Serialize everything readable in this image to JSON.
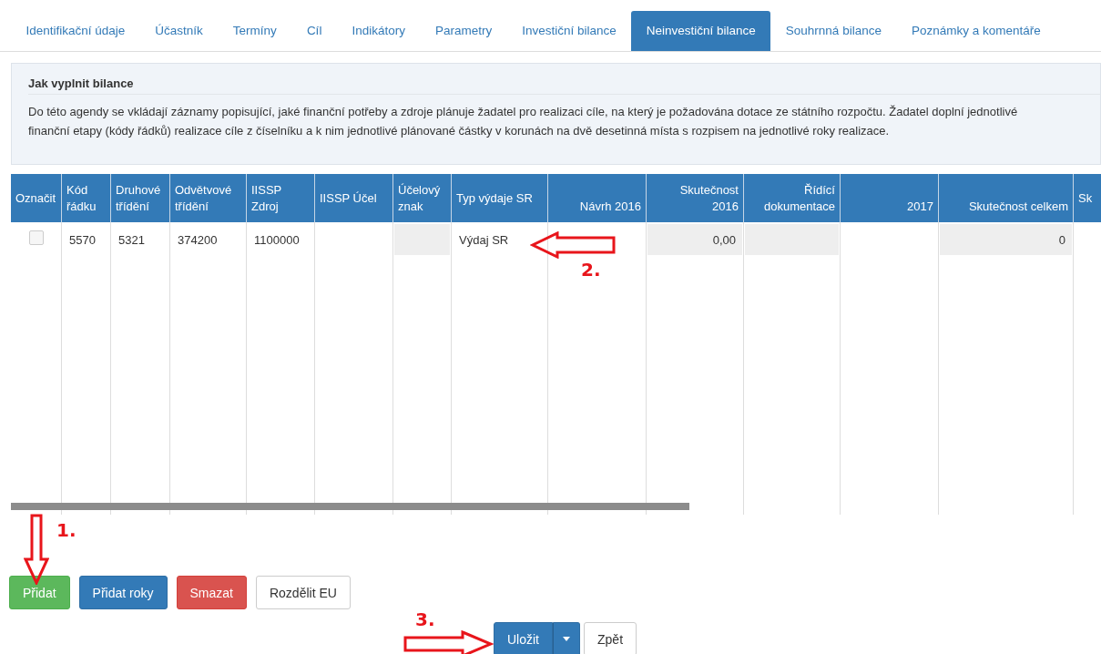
{
  "tabs": [
    {
      "label": "Identifikační údaje",
      "selected": false
    },
    {
      "label": "Účastník",
      "selected": false
    },
    {
      "label": "Termíny",
      "selected": false
    },
    {
      "label": "Cíl",
      "selected": false
    },
    {
      "label": "Indikátory",
      "selected": false
    },
    {
      "label": "Parametry",
      "selected": false
    },
    {
      "label": "Investiční bilance",
      "selected": false
    },
    {
      "label": "Neinvestiční bilance",
      "selected": true
    },
    {
      "label": "Souhrnná bilance",
      "selected": false
    },
    {
      "label": "Poznámky a komentáře",
      "selected": false
    }
  ],
  "help": {
    "title": "Jak vyplnit bilance",
    "text": "Do této agendy se vkládají záznamy popisující, jaké finanční potřeby a zdroje plánuje žadatel pro realizaci cíle, na který je požadována dotace ze státního rozpočtu. Žadatel doplní jednotlivé finanční etapy (kódy řádků) realizace cíle z číselníku a k nim jednotlivé plánované částky v korunách na dvě desetinná místa s rozpisem na jednotlivé roky realizace."
  },
  "table": {
    "columns": [
      "Označit",
      "Kód řádku",
      "Druhové třídění",
      "Odvětvové třídění",
      "IISSP Zdroj",
      "IISSP Účel",
      "Účelový znak",
      "Typ výdaje SR",
      "Návrh 2016",
      "Skutečnost 2016",
      "Řídící dokumentace",
      "2017",
      "Skutečnost celkem",
      "Sk"
    ],
    "rows": [
      {
        "cells": [
          {
            "kind": "checkbox",
            "checked": false
          },
          {
            "text": "5570",
            "readonly": false
          },
          {
            "text": "5321",
            "readonly": false
          },
          {
            "text": "374200",
            "readonly": false
          },
          {
            "text": "1100000",
            "readonly": false
          },
          {
            "text": "",
            "readonly": false
          },
          {
            "text": "",
            "readonly": true
          },
          {
            "text": "Výdaj SR",
            "readonly": false
          },
          {
            "text": "",
            "readonly": false
          },
          {
            "text": "0,00",
            "readonly": true
          },
          {
            "text": "",
            "readonly": true
          },
          {
            "text": "",
            "readonly": false
          },
          {
            "text": "0",
            "readonly": true
          },
          {
            "text": "",
            "readonly": false
          }
        ]
      }
    ]
  },
  "buttons": [
    {
      "label": "Přidat",
      "kind": "success"
    },
    {
      "label": "Přidat roky",
      "kind": "primary"
    },
    {
      "label": "Smazat",
      "kind": "danger"
    },
    {
      "label": "Rozdělit EU",
      "kind": "default"
    }
  ],
  "footer_buttons": [
    {
      "label": "Uložit",
      "kind": "split"
    },
    {
      "label": "Zpět",
      "kind": "default"
    }
  ],
  "annotations": [
    {
      "label": "1.",
      "kind": "down"
    },
    {
      "label": "2.",
      "kind": "left"
    },
    {
      "label": "3.",
      "kind": "right"
    }
  ]
}
